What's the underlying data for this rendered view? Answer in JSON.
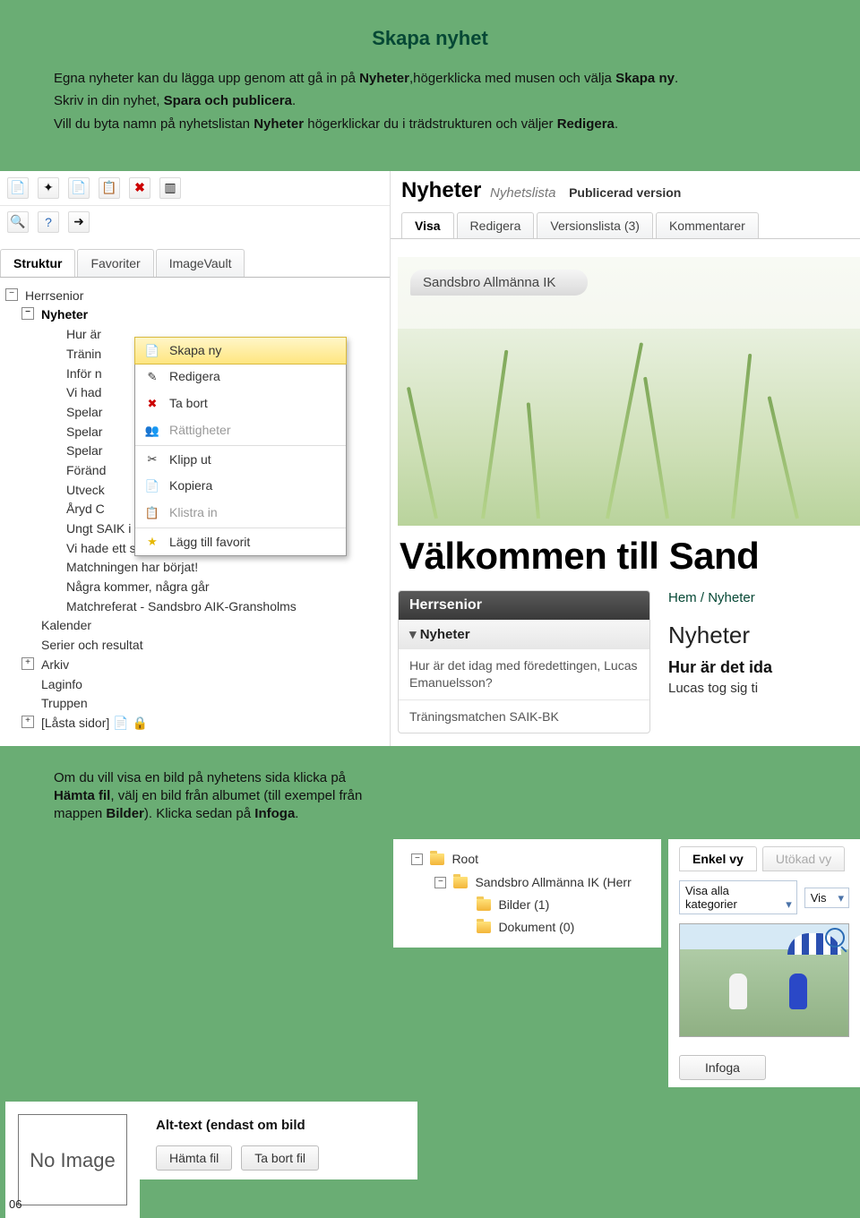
{
  "intro": {
    "title": "Skapa nyhet",
    "p1a": "Egna nyheter kan du lägga upp genom att gå in på ",
    "p1b_bold": "Nyheter",
    "p1c": ",högerklicka med musen och välja ",
    "p1d_bold": "Skapa ny",
    "p1e": ".",
    "p2a": "Skriv in din nyhet, ",
    "p2b_bold": "Spara och publicera",
    "p2c": ".",
    "p3a": "Vill du byta namn på nyhetslistan ",
    "p3b_bold": "Nyheter",
    "p3c": " högerklickar du i trädstrukturen och väljer ",
    "p3d_bold": "Redigera",
    "p3e": "."
  },
  "shot1": {
    "sidetabs": {
      "struktur": "Struktur",
      "favoriter": "Favoriter",
      "imagevault": "ImageVault"
    },
    "tree": {
      "herrsenior": "Herrsenior",
      "nyheter": "Nyheter",
      "items": [
        "Hur är",
        "Tränin",
        "Inför n",
        "Vi had",
        "Spelar",
        "Spelar",
        "Spelar",
        "Föränd",
        "Utveck",
        "Åryd C",
        "Ungt SAIK i Åryd Cup",
        "Vi hade ett samtal med vår nye A-lagsträn",
        "Matchningen har börjat!",
        "Några kommer, några går",
        "Matchreferat - Sandsbro AIK-Gransholms"
      ],
      "kalender": "Kalender",
      "serier": "Serier och resultat",
      "arkiv": "Arkiv",
      "laginfo": "Laginfo",
      "truppen": "Truppen",
      "lasta": "[Låsta sidor]"
    },
    "context": {
      "skapa": "Skapa ny",
      "redigera": "Redigera",
      "tabort": "Ta bort",
      "ratt": "Rättigheter",
      "klipp": "Klipp ut",
      "kopiera": "Kopiera",
      "klistra": "Klistra in",
      "favorit": "Lägg till favorit"
    },
    "right": {
      "title": "Nyheter",
      "subtitle": "Nyhetslista",
      "pub": "Publicerad version",
      "tabs": {
        "visa": "Visa",
        "redigera": "Redigera",
        "versions": "Versionslista (3)",
        "komm": "Kommentarer"
      },
      "pill": "Sandsbro Allmänna IK",
      "welcome": "Välkommen till Sand",
      "sidecard": {
        "head": "Herrsenior",
        "sub": "Nyheter",
        "link1": "Hur är det idag med föredettingen, Lucas Emanuelsson?",
        "link2": "Träningsmatchen SAIK-BK"
      },
      "breadcrumb": {
        "hem": "Hem",
        "sep": " / ",
        "nyheter": "Nyheter"
      },
      "h2": "Nyheter",
      "h3": "Hur är det ida",
      "desc": "Lucas tog sig ti"
    }
  },
  "text2": {
    "a": "Om du vill visa en bild på nyhetens sida klicka på ",
    "b_bold": "Hämta fil",
    "c": ", välj en bild från albumet (till exempel från mappen ",
    "d_bold": "Bilder",
    "e": "). Klicka sedan på ",
    "f_bold": "Infoga",
    "g": "."
  },
  "folders": {
    "root": "Root",
    "club": "Sandsbro Allmänna IK (Herr",
    "bilder": "Bilder (1)",
    "dokument": "Dokument (0)"
  },
  "views": {
    "enkel": "Enkel vy",
    "utokad": "Utökad vy",
    "select": "Visa alla kategorier",
    "vis": "Vis",
    "infoga": "Infoga"
  },
  "bottom": {
    "noimage": "No Image",
    "alt": "Alt-text (endast om bild",
    "hamta": "Hämta fil",
    "tabort": "Ta bort fil"
  },
  "pagenum": "06"
}
